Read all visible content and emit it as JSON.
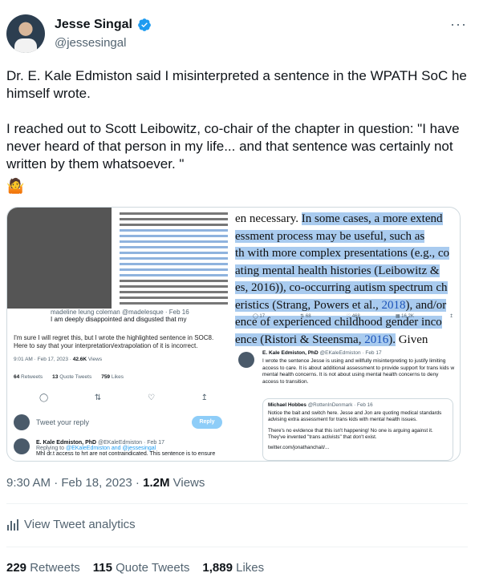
{
  "author": {
    "name": "Jesse Singal",
    "handle": "@jessesingal",
    "verified_color": "#1d9bf0"
  },
  "more_label": "···",
  "tweet": {
    "paragraph1": "Dr. E. Kale Edmiston said I misinterpreted a sentence in the WPATH SoC he himself wrote.",
    "paragraph2": "I reached out to Scott Leibowitz, co-chair of the chapter in question: \"I have never heard of that person in my life... and that sentence was certainly not written by them whatsoever. \"",
    "emoji": "🤷"
  },
  "media_left": {
    "reply_name": "madeline leung coleman",
    "reply_handle": "@madelesque · Feb 16",
    "reply_text": "I am deeply disappointed and disgusted that my",
    "body": "I'm sure I will regret this, but I wrote the highlighted sentence in SOC8. Here to say that your interpretation/extrapolation of it is incorrect.",
    "time": "9:01 AM · Feb 17, 2023 ·",
    "views": "42.6K",
    "views_label": "Views",
    "retweets": "64",
    "retweets_label": "Retweets",
    "quotes": "13",
    "quotes_label": "Quote Tweets",
    "likes": "759",
    "likes_label": "Likes",
    "reply_placeholder": "Tweet your reply",
    "reply_button": "Reply",
    "reply2_name": "E. Kale Edmiston, PhD",
    "reply2_handle": "@EKaleEdmiston · Feb 17",
    "reply2_to": "Replying to",
    "reply2_users": "@EKaleEdmiston and @jessesingal",
    "reply2_text": "Mhl dr.t access to hrt are not contraindicated. This sentence is to ensure"
  },
  "media_right": {
    "lines": [
      {
        "pre": "en necessary. ",
        "hl": "In some cases, a more extend",
        "link": ""
      },
      {
        "pre": "",
        "hl": "essment process may be useful, such as",
        "link": ""
      },
      {
        "pre": "",
        "hl": "th with more complex presentations (e.g., co",
        "link": ""
      },
      {
        "pre": "",
        "hl": "ating mental health histories (Leibowitz &",
        "link": ""
      },
      {
        "pre": "",
        "hl": "es, 2016)), co-occurring autism spectrum ch",
        "link": ""
      },
      {
        "pre": "",
        "hl": "eristics (Strang, Powers et al., ",
        "link": "2018"
      },
      {
        "pre": "",
        "hl": "ence of experienced childhood gender inco",
        "link": ""
      },
      {
        "pre": "",
        "hl": "ence (Ristori & Steensma, ",
        "link": "2016"
      }
    ],
    "line6_tail": "), and/or",
    "line8_tail": ").",
    "line8_after": " Given",
    "actions": [
      "17",
      "68",
      "468",
      "16.2K"
    ],
    "tweet_name": "E. Kale Edmiston, PhD",
    "tweet_handle": "@EKaleEdmiston · Feb 17",
    "tweet_text": "I wrote the sentence Jesse is using and willfully misinterpreting to justify limiting access to care. It is about additional assessment to provide support for trans kids w mental health concerns. It is not about using mental health concerns to deny access to transition.",
    "quote_name": "Michael Hobbes",
    "quote_handle": "@RottenInDenmark · Feb 16",
    "quote_p1": "Notice the bait and switch here. Jesse and Jon are quoting medical standards advising extra assessment for trans kids with mental health issues.",
    "quote_p2": "There's no evidence that this isn't happening! No one is arguing against it. They've invented \"trans activists\" that don't exist.",
    "quote_link": "twitter.com/jonathanchait/..."
  },
  "meta": {
    "time": "9:30 AM · Feb 18, 2023 ·",
    "views": "1.2M",
    "views_label": "Views"
  },
  "analytics_label": "View Tweet analytics",
  "stats": {
    "retweets": "229",
    "retweets_label": "Retweets",
    "quotes": "115",
    "quotes_label": "Quote Tweets",
    "likes": "1,889",
    "likes_label": "Likes"
  }
}
